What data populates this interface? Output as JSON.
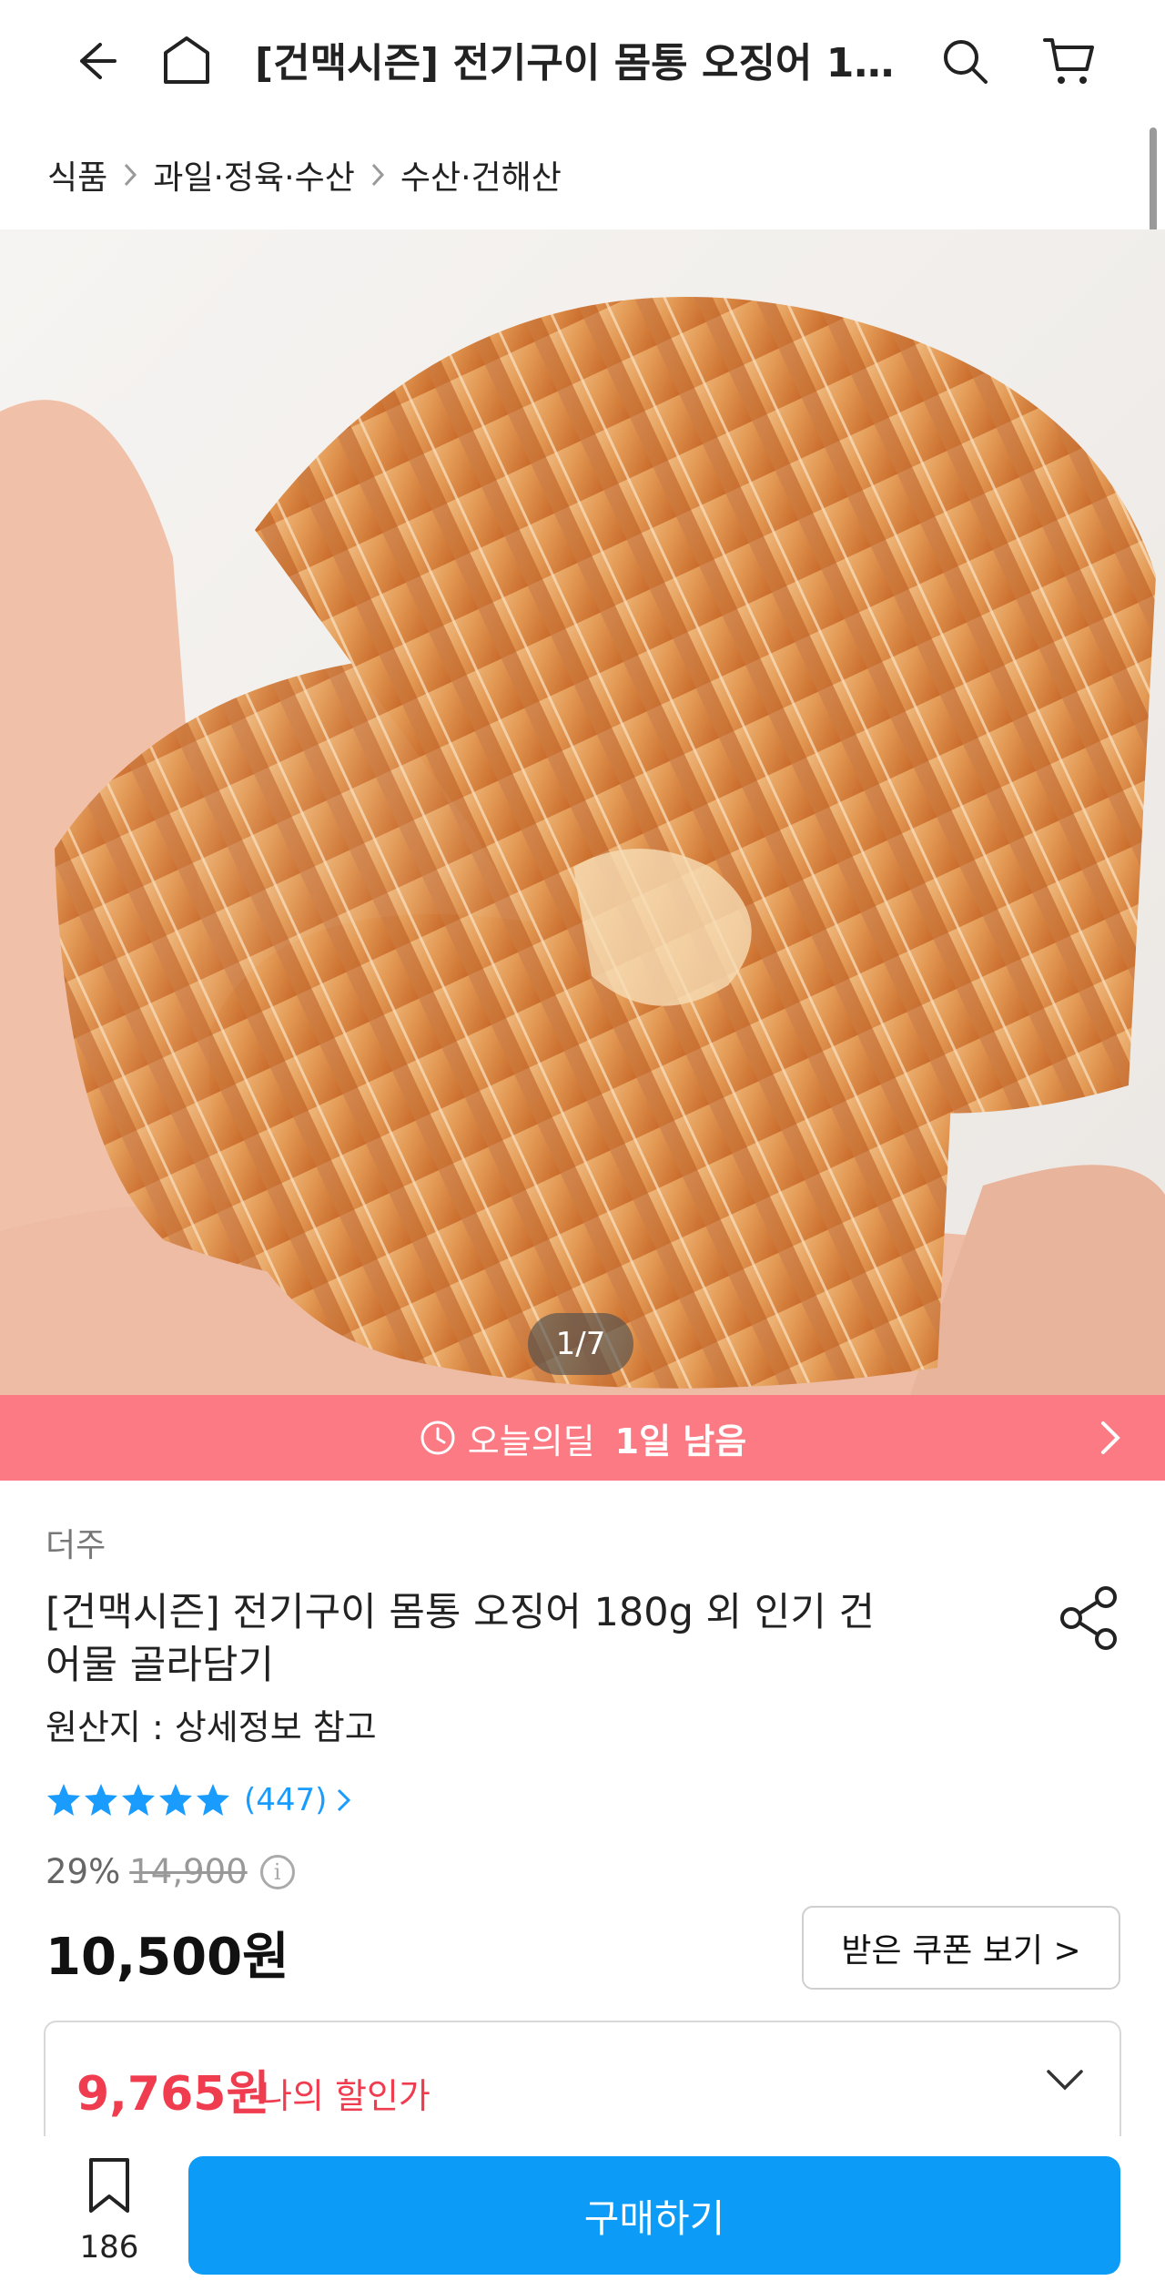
{
  "header": {
    "title": "[건맥시즌] 전기구이 몸통 오징어 180...",
    "icons": [
      "back-arrow-icon",
      "home-icon",
      "search-icon",
      "cart-icon"
    ]
  },
  "breadcrumb": [
    "식품",
    "과일·정육·수산",
    "수산·건해산"
  ],
  "gallery": {
    "counter": "1/7"
  },
  "deal": {
    "label": "오늘의딜",
    "remaining": "1일 남음",
    "color": "#fb7a83"
  },
  "product": {
    "brand": "더주",
    "title": "[건맥시즌] 전기구이 몸통 오징어 180g 외 인기 건어물 골라담기",
    "origin": "원산지 : 상세정보 참고",
    "rating": {
      "stars": 5,
      "review_count": "(447)"
    },
    "discount_percent": "29%",
    "original_price": "14,900",
    "price": "10,500원"
  },
  "coupon": {
    "button_label": "받은 쿠폰 보기 >"
  },
  "my_price": {
    "amount": "9,765원",
    "label": "나의 할인가"
  },
  "bottom": {
    "bookmark_count": "186",
    "buy_label": "구매하기",
    "accent": "#0c9cf7"
  }
}
